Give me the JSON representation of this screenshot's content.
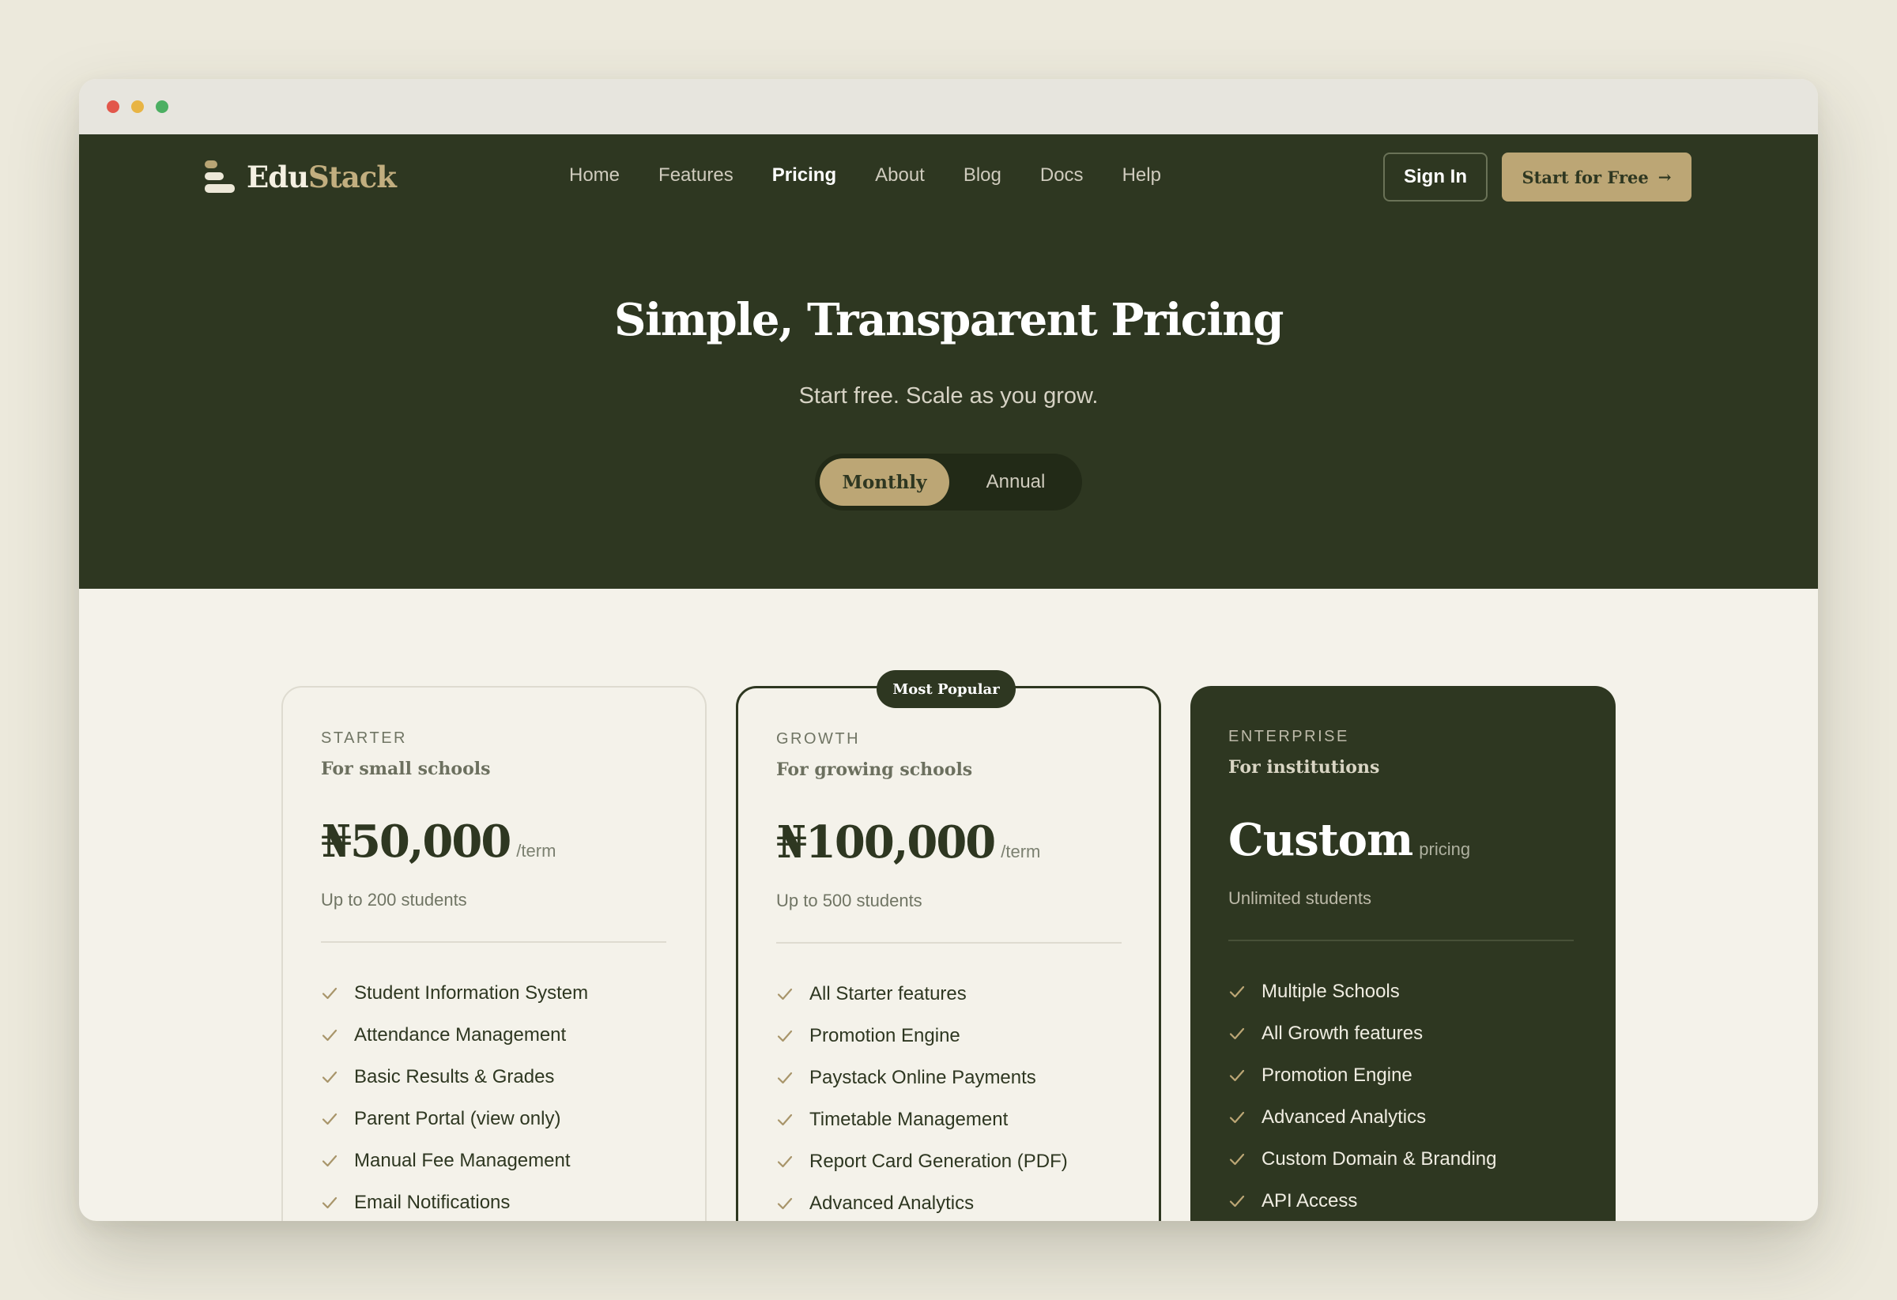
{
  "brand": {
    "name_primary": "Edu",
    "name_accent": "Stack",
    "colors": {
      "dark_green": "#2e3721",
      "gold": "#bca675",
      "cream": "#f4f2ea"
    }
  },
  "nav": {
    "links": [
      "Home",
      "Features",
      "Pricing",
      "About",
      "Blog",
      "Docs",
      "Help"
    ],
    "active": "Pricing",
    "sign_in": "Sign In",
    "start_free": "Start for Free",
    "start_free_icon": "arrow-right-icon"
  },
  "hero": {
    "title": "Simple, Transparent Pricing",
    "subtitle": "Start free. Scale as you grow.",
    "toggle": {
      "monthly": "Monthly",
      "annual": "Annual",
      "selected": "Monthly"
    }
  },
  "plans": [
    {
      "tier": "STARTER",
      "tagline": "For small schools",
      "price": "₦50,000",
      "unit": "/term",
      "students": "Up to 200 students",
      "features": [
        "Student Information System",
        "Attendance Management",
        "Basic Results & Grades",
        "Parent Portal (view only)",
        "Manual Fee Management",
        "Email Notifications"
      ]
    },
    {
      "tier": "GROWTH",
      "badge": "Most Popular",
      "tagline": "For growing schools",
      "price": "₦100,000",
      "unit": "/term",
      "students": "Up to 500 students",
      "features": [
        "All Starter features",
        "Promotion Engine",
        "Paystack Online Payments",
        "Timetable Management",
        "Report Card Generation (PDF)",
        "Advanced Analytics"
      ]
    },
    {
      "tier": "ENTERPRISE",
      "tagline": "For institutions",
      "price": "Custom",
      "unit": "pricing",
      "students": "Unlimited students",
      "features": [
        "Multiple Schools",
        "All Growth features",
        "Promotion Engine",
        "Advanced Analytics",
        "Custom Domain & Branding",
        "API Access"
      ]
    }
  ]
}
